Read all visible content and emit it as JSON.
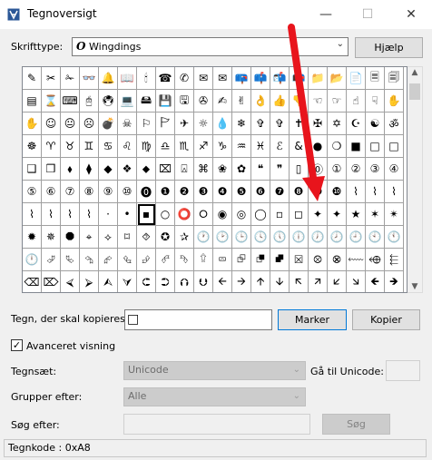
{
  "window": {
    "title": "Tegnoversigt",
    "app_icon": "charmap-icon"
  },
  "font_row": {
    "label": "Skrifttype:",
    "font_icon": "opentype-icon",
    "font_glyph": "O",
    "value": "Wingdings",
    "help_label": "Hjælp"
  },
  "glyphs": [
    "✎",
    "✂",
    "✁",
    "👓",
    "🔔",
    "📖",
    "🕯",
    "☎",
    "✆",
    "✉",
    "✉",
    "📪",
    "📫",
    "📬",
    "📭",
    "📁",
    "📂",
    "📄",
    "🗏",
    "🗐",
    "▤",
    "⌛",
    "⌨",
    "🖰",
    "🖲",
    "💻",
    "🖴",
    "💾",
    "🖫",
    "✇",
    "✍",
    "✌",
    "👌",
    "👍",
    "👎",
    "☜",
    "☞",
    "☝",
    "☟",
    "✋",
    "✋",
    "☺",
    "😐",
    "☹",
    "💣",
    "☠",
    "⚐",
    "🏱",
    "✈",
    "☼",
    "💧",
    "❄",
    "✞",
    "✞",
    "✝",
    "✠",
    "✡",
    "☪",
    "☯",
    "ॐ",
    "☸",
    "♈",
    "♉",
    "♊",
    "♋",
    "♌",
    "♍",
    "♎",
    "♏",
    "♐",
    "♑",
    "♒",
    "♓",
    "ℰ",
    "&",
    "●",
    "❍",
    "■",
    "□",
    "□",
    "❑",
    "❒",
    "⬧",
    "⧫",
    "◆",
    "❖",
    "⬥",
    "⌧",
    "⍓",
    "⌘",
    "❀",
    "✿",
    "❝",
    "❞",
    "▯",
    "⓪",
    "①",
    "②",
    "③",
    "④",
    "⑤",
    "⑥",
    "⑦",
    "⑧",
    "⑨",
    "⑩",
    "⓿",
    "❶",
    "❷",
    "❸",
    "❹",
    "❺",
    "❻",
    "❼",
    "❽",
    "❾",
    "❿",
    "⌇",
    "⌇",
    "⌇",
    "⌇",
    "⌇",
    "⌇",
    "⌇",
    "·",
    "•",
    "▪",
    "○",
    "⭕",
    "⭘",
    "◉",
    "◎",
    "◯",
    "▫",
    "◻",
    "✦",
    "✦",
    "★",
    "✶",
    "✴",
    "✹",
    "✵",
    "⯃",
    "⌖",
    "⟡",
    "⌑",
    "⯑",
    "✪",
    "✰",
    "🕐",
    "🕑",
    "🕒",
    "🕓",
    "🕔",
    "🕕",
    "🕖",
    "🕗",
    "🕘",
    "🕙",
    "🕚",
    "🕛",
    "⮰",
    "⮱",
    "⮲",
    "⮳",
    "⮴",
    "⮵",
    "⮶",
    "⮷",
    "⮸",
    "⮹",
    "⮺",
    "⮻",
    "⮼",
    "⮽",
    "⮾",
    "⮿",
    "⬳",
    "⬲",
    "⬱",
    "⌫",
    "⌦",
    "⮘",
    "⮚",
    "⮙",
    "⮛",
    "⮈",
    "⮊",
    "⮉",
    "⮋",
    "🡨",
    "🡪",
    "🡩",
    "🡫",
    "🡬",
    "🡭",
    "🡯",
    "🡮",
    "🡸",
    "🡺"
  ],
  "selected_glyph_index": 126,
  "copy_row": {
    "label": "Tegn, der skal kopieres:",
    "value": "□",
    "select_label": "Marker",
    "copy_label": "Kopier"
  },
  "advanced": {
    "checkbox_label": "Avanceret visning",
    "checked": true,
    "check_glyph": "✓"
  },
  "charset": {
    "label": "Tegnsæt:",
    "value": "Unicode",
    "goto_label": "Gå til Unicode:"
  },
  "group_by": {
    "label": "Grupper efter:",
    "value": "Alle"
  },
  "search": {
    "label": "Søg efter:",
    "button_label": "Søg"
  },
  "status": {
    "text": "Tegnkode : 0xA8"
  },
  "annotation": {
    "color": "#e8141c"
  }
}
